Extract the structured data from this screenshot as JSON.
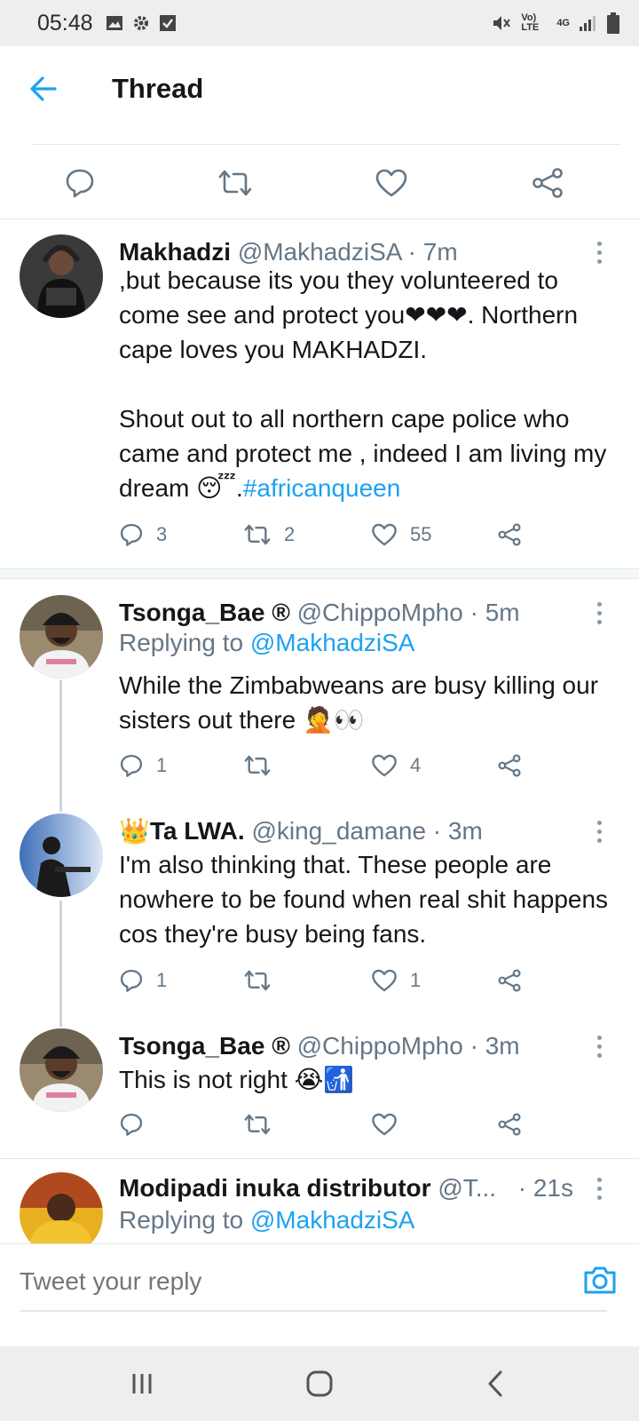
{
  "status_bar": {
    "time": "05:48",
    "network_label": "Vo) LTE",
    "network_type": "4G"
  },
  "header": {
    "title": "Thread"
  },
  "tweets": [
    {
      "name": "Makhadzi",
      "handle": "@MakhadziSA",
      "time": "· 7m",
      "text_main": ",but because its you they volunteered to come see and protect you❤❤❤. Northern cape loves you MAKHADZI.\n\nShout out to all northern cape police who came and protect me , indeed I am living my dream 😴.",
      "hashtag": "#africanqueen",
      "replies": "3",
      "retweets": "2",
      "likes": "55"
    },
    {
      "name": "Tsonga_Bae",
      "badge": "®",
      "handle": "@ChippoMpho",
      "time": "· 5m",
      "replying_label": "Replying to",
      "replying_to": "@MakhadziSA",
      "text": "While the Zimbabweans are busy killing our sisters out there 🤦👀",
      "replies": "1",
      "retweets": "",
      "likes": "4"
    },
    {
      "name": "👑Ta LWA.",
      "handle": "@king_damane",
      "time": "· 3m",
      "text": "I'm also thinking that. These people are nowhere to be found when real shit happens cos they're busy being fans.",
      "replies": "1",
      "retweets": "",
      "likes": "1"
    },
    {
      "name": "Tsonga_Bae",
      "badge": "®",
      "handle": "@ChippoMpho",
      "time": "· 3m",
      "text": "This is not right 😭🚮",
      "replies": "",
      "retweets": "",
      "likes": ""
    },
    {
      "name": "Modipadi inuka distributor",
      "handle": "@T...",
      "time": "· 21s",
      "replying_label": "Replying to",
      "replying_to": "@MakhadziSA"
    }
  ],
  "reply_bar": {
    "placeholder": "Tweet your reply"
  },
  "colors": {
    "accent": "#1da1f2",
    "heart_red": "#e0245e",
    "text_gray": "#657786"
  },
  "icons": [
    "back-arrow-icon",
    "reply-icon",
    "retweet-icon",
    "like-icon",
    "share-icon",
    "more-icon",
    "camera-icon",
    "recents-icon",
    "home-icon",
    "back-icon"
  ]
}
